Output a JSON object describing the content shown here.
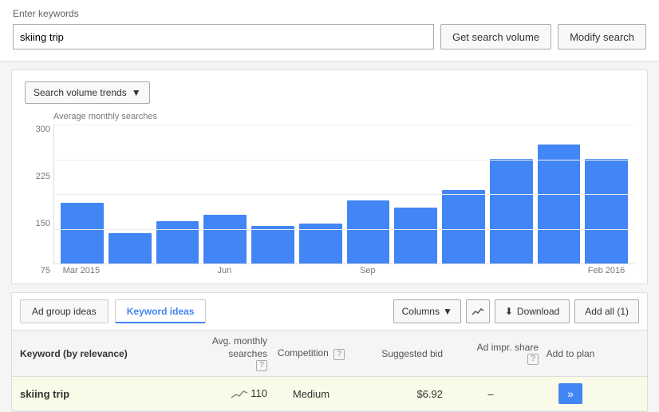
{
  "header": {
    "label": "Enter keywords",
    "input_value": "skiing trip",
    "input_placeholder": "skiing trip"
  },
  "buttons": {
    "get_search_volume": "Get search volume",
    "modify_search": "Modify search",
    "columns": "Columns",
    "download": "Download",
    "add_all": "Add all (1)"
  },
  "chart": {
    "title": "Search volume trends",
    "y_label": "Average monthly searches",
    "y_ticks": [
      "300",
      "225",
      "150",
      "75"
    ],
    "bars": [
      {
        "label": "Mar 2015",
        "value": 130,
        "show_label": true
      },
      {
        "label": "",
        "value": 65,
        "show_label": false
      },
      {
        "label": "",
        "value": 90,
        "show_label": false
      },
      {
        "label": "Jun",
        "value": 105,
        "show_label": true
      },
      {
        "label": "",
        "value": 80,
        "show_label": false
      },
      {
        "label": "",
        "value": 85,
        "show_label": false
      },
      {
        "label": "Sep",
        "value": 135,
        "show_label": true
      },
      {
        "label": "",
        "value": 120,
        "show_label": false
      },
      {
        "label": "",
        "value": 157,
        "show_label": false
      },
      {
        "label": "",
        "value": 225,
        "show_label": false
      },
      {
        "label": "",
        "value": 255,
        "show_label": false
      },
      {
        "label": "Feb 2016",
        "value": 225,
        "show_label": true
      }
    ],
    "max_value": 300
  },
  "tabs": {
    "ad_group": "Ad group ideas",
    "keyword": "Keyword ideas"
  },
  "table": {
    "headers": {
      "keyword": "Keyword (by relevance)",
      "avg_monthly": "Avg. monthly searches",
      "competition": "Competition",
      "suggested_bid": "Suggested bid",
      "ad_impr_share": "Ad impr. share",
      "add_to_plan": "Add to plan"
    },
    "rows": [
      {
        "keyword": "skiing trip",
        "avg_monthly": "110",
        "competition": "Medium",
        "suggested_bid": "$6.92",
        "ad_impr_share": "–"
      }
    ]
  }
}
